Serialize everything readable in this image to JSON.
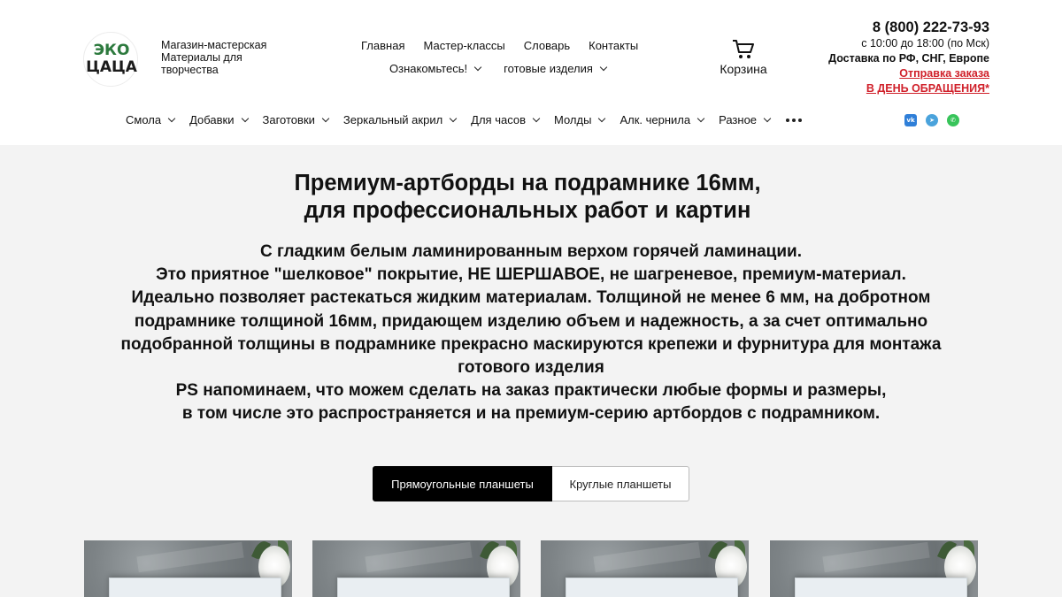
{
  "logo": {
    "line1": "ЭКО",
    "line2": "ЦАЦА"
  },
  "tagline": [
    "Магазин-мастерская",
    "Материалы для",
    "творчества"
  ],
  "topnav": {
    "row1": [
      "Главная",
      "Мастер-классы",
      "Словарь",
      "Контакты"
    ],
    "row2": [
      "Ознакомьтесь!",
      "готовые изделия"
    ]
  },
  "cart": {
    "icon": "cart-icon",
    "label": "Корзина"
  },
  "contact": {
    "phone": "8 (800) 222-73-93",
    "hours": "с 10:00 до 18:00 (по Мск)",
    "delivery": "Доставка по РФ, СНГ, Европе",
    "shipping_line1": "Отправка заказа",
    "shipping_line2": "В ДЕНЬ ОБРАЩЕНИЯ*"
  },
  "catnav": [
    "Смола",
    "Добавки",
    "Заготовки",
    "Зеркальный акрил",
    "Для часов",
    "Молды",
    "Алк. чернила",
    "Разное"
  ],
  "social": [
    {
      "name": "vk-icon",
      "glyph": "vk",
      "color": "#2f7fd8"
    },
    {
      "name": "telegram-icon",
      "glyph": "➤",
      "color": "#4aa3dc"
    },
    {
      "name": "whatsapp-icon",
      "glyph": "✆",
      "color": "#38c45a"
    }
  ],
  "hero": {
    "title_line1": "Премиум-артборды на подрамнике 16мм,",
    "title_line2": "для профессиональных работ и картин",
    "desc": [
      "С гладким белым ламинированным верхом горячей ламинации.",
      "Это приятное \"шелковое\" покрытие,  НЕ ШЕРШАВОЕ, не шагреневое, премиум-материал.",
      "Идеально позволяет растекаться жидким материалам. Толщиной не менее 6 мм, на добротном",
      "подрамнике толщиной 16мм, придающем изделию объем и надежность, а за счет оптимально",
      "подобранной толщины в подрамнике прекрасно маскируются крепежи и фурнитура для монтажа",
      "готового изделия",
      "PS напоминаем, что можем сделать на заказ практически любые формы и размеры,",
      "в том числе это распространяется и на премиум-серию артбордов с подрамником."
    ]
  },
  "tabs": {
    "active": "Прямоугольные планшеты",
    "inactive": "Круглые планшеты"
  },
  "colors": {
    "accent_red": "#d0202a",
    "logo_green": "#2d7a3e",
    "tab_active_bg": "#000000",
    "page_bg": "#f3f3f3"
  }
}
